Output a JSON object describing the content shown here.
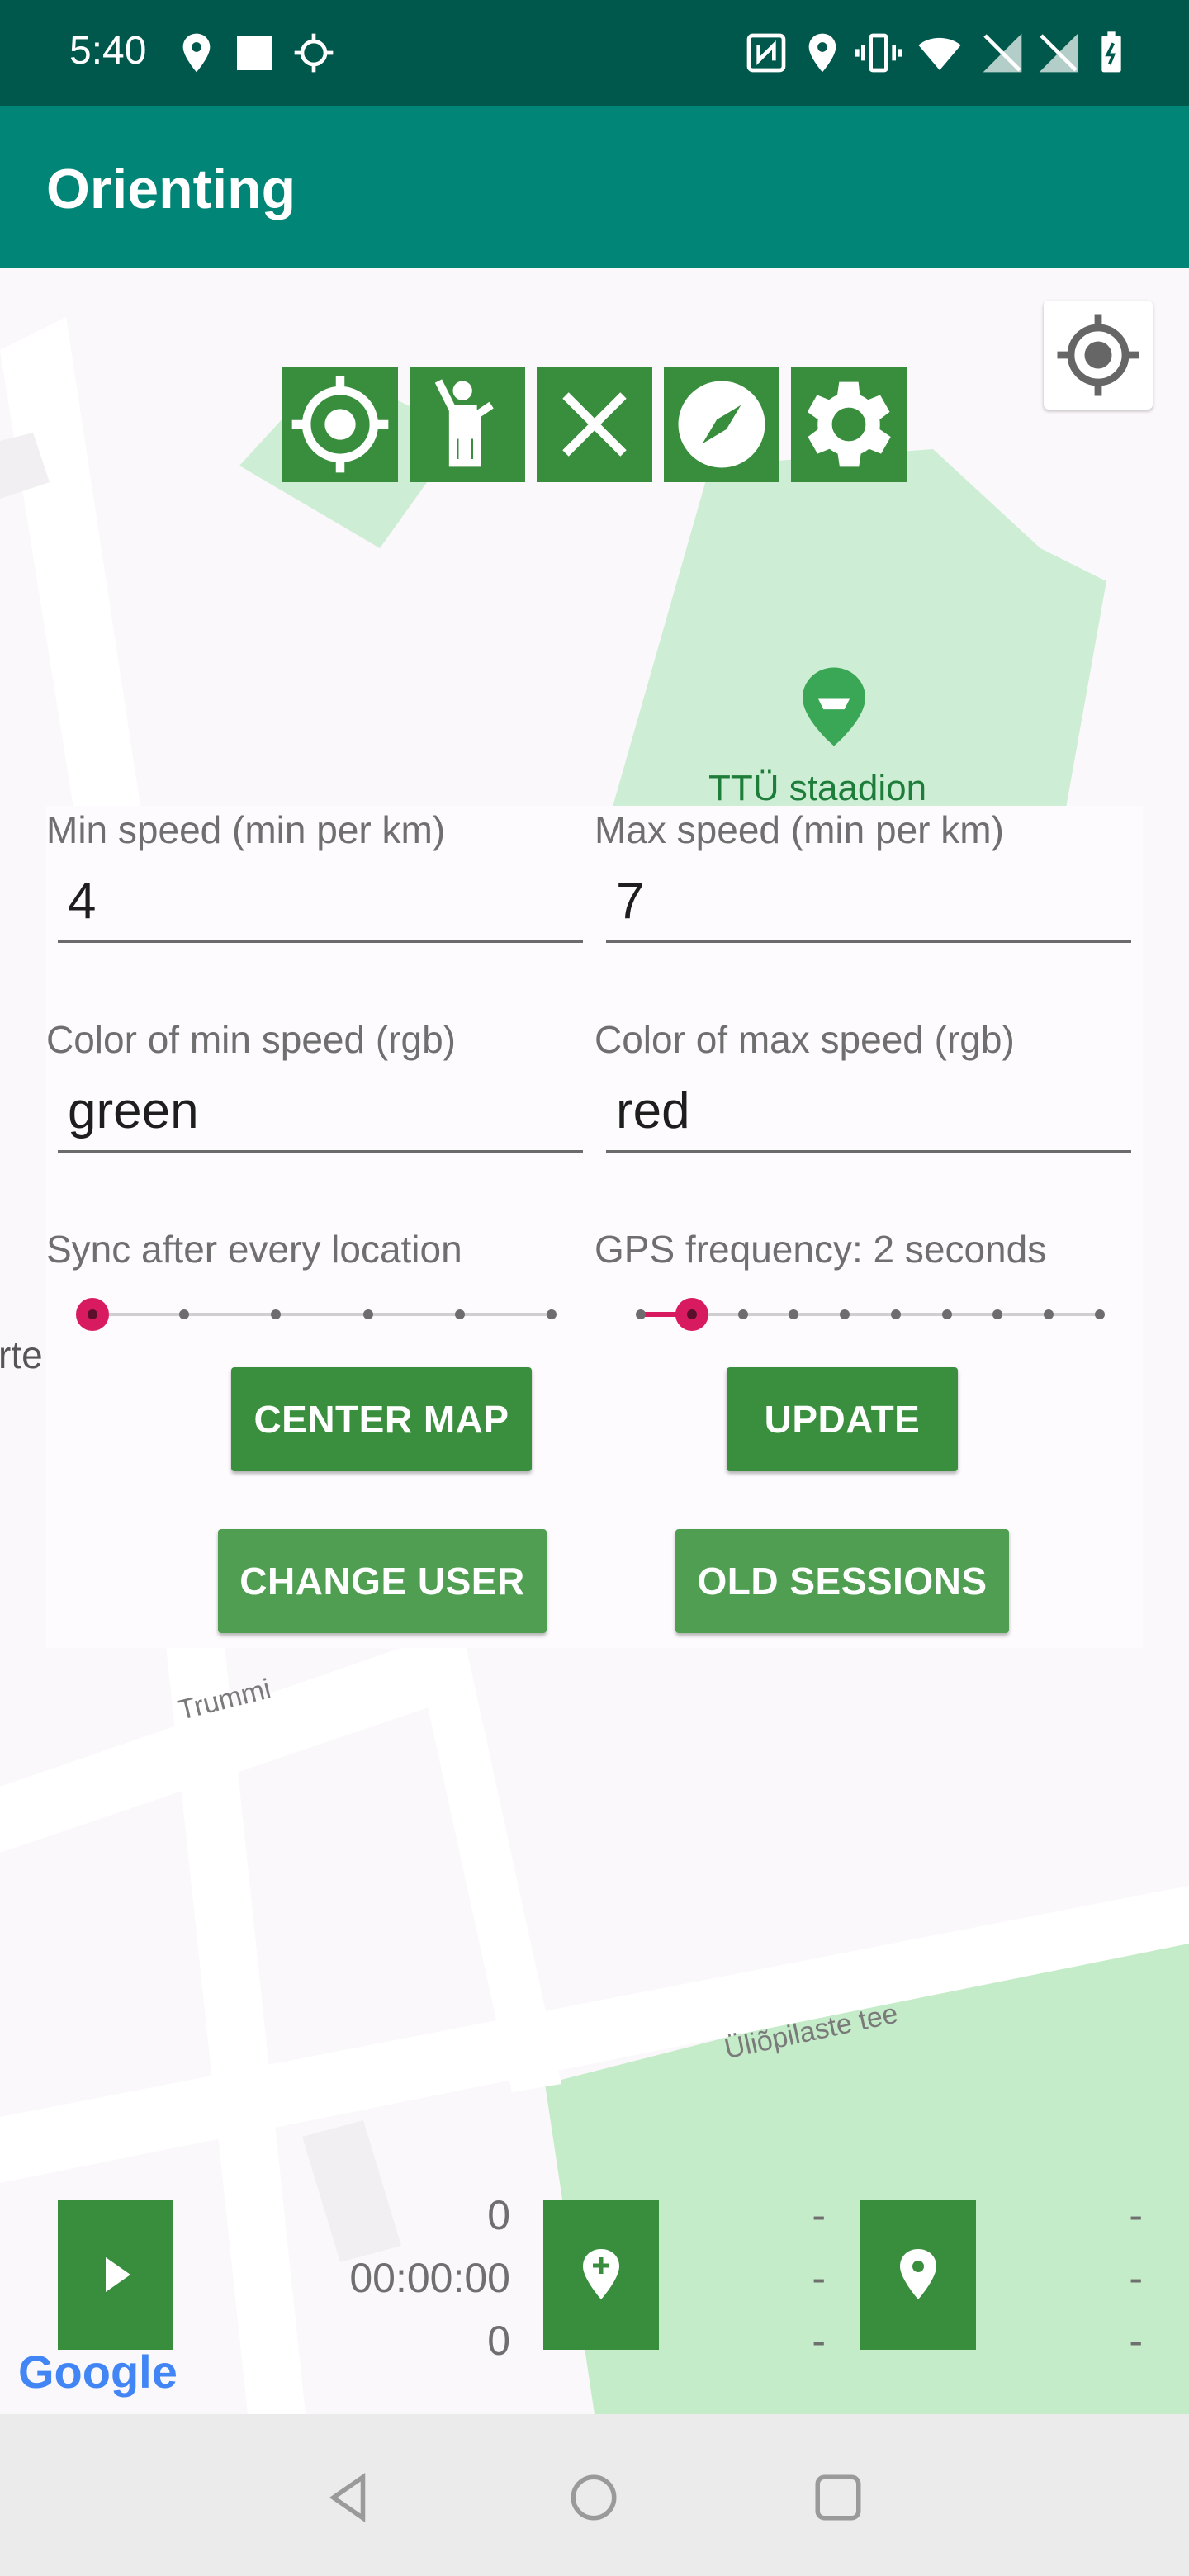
{
  "status_bar": {
    "time": "5:40"
  },
  "app_bar": {
    "title": "Orienting"
  },
  "map": {
    "labels": {
      "stadium": "TTÜ staadion",
      "street1": "Trummi",
      "street2": "Üliõpilaste tee",
      "edge": "rte"
    },
    "attribution": "Google"
  },
  "toolbar": {
    "icons": [
      "target-icon",
      "person-waving-icon",
      "close-icon",
      "compass-icon",
      "gear-icon"
    ]
  },
  "settings": {
    "min_speed": {
      "label": "Min speed (min per km)",
      "value": "4"
    },
    "max_speed": {
      "label": "Max speed (min per km)",
      "value": "7"
    },
    "min_color": {
      "label": "Color of min speed (rgb)",
      "value": "green"
    },
    "max_color": {
      "label": "Color of max speed (rgb)",
      "value": "red"
    },
    "sync": {
      "label": "Sync after every location",
      "level": 0,
      "steps": 6
    },
    "gps": {
      "label": "GPS frequency: 2 seconds",
      "level": 1,
      "steps": 10
    },
    "buttons": {
      "center_map": "CENTER MAP",
      "update": "UPDATE",
      "change_user": "CHANGE USER",
      "old_sessions": "OLD SESSIONS"
    }
  },
  "session": {
    "distance": "0",
    "duration": "00:00:00",
    "pace": "0",
    "checkpoint": [
      "-",
      "-",
      "-"
    ],
    "waypoint": [
      "-",
      "-",
      "-"
    ]
  },
  "colors": {
    "status_bar": "#00574b",
    "app_bar": "#008577",
    "button": "#388e3c",
    "slider_accent": "#d81b60"
  }
}
